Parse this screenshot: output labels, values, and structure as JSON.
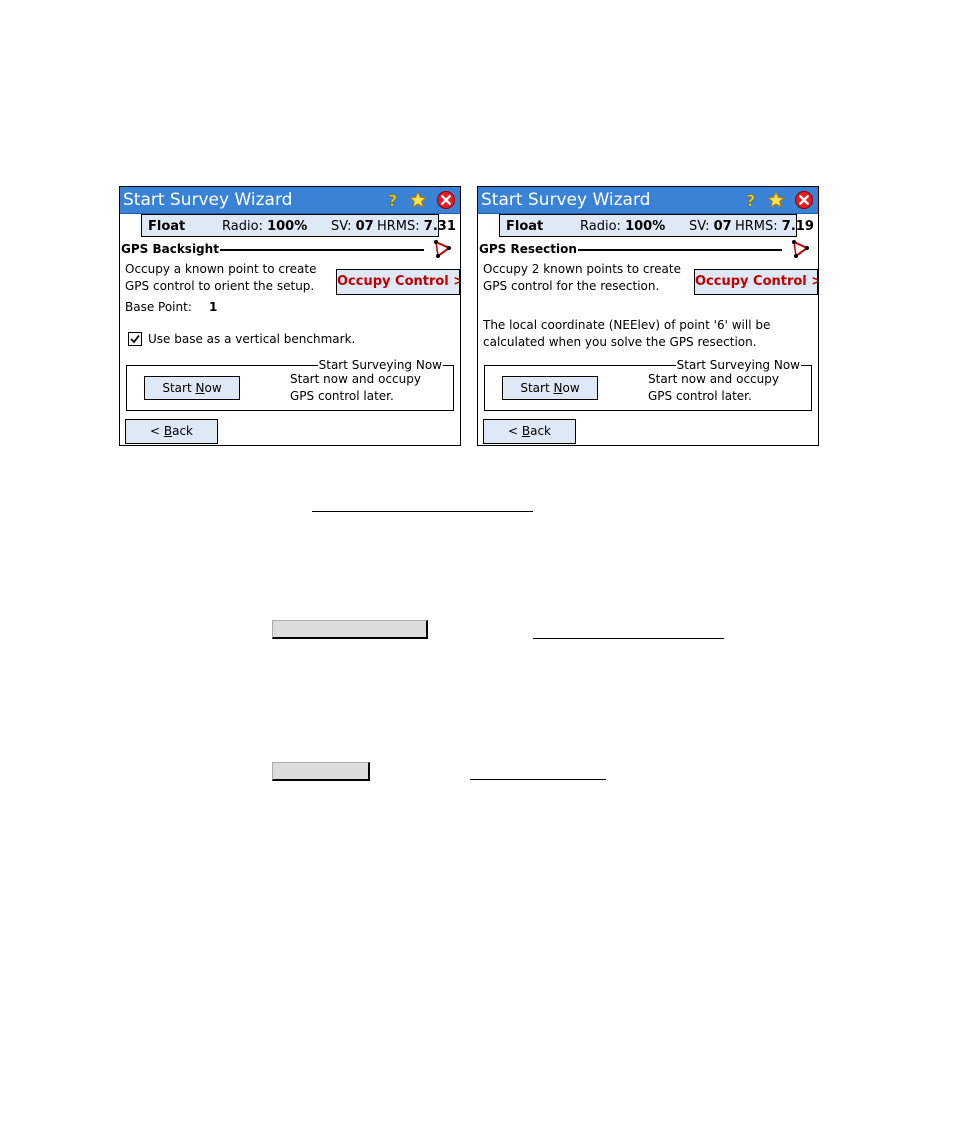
{
  "panels": [
    {
      "title": "Start Survey Wizard",
      "status": {
        "mode": "Float",
        "radio_label": "Radio:",
        "radio_value": "100%",
        "sv_label": "SV:",
        "sv_value": "07",
        "hrms_label": "HRMS:",
        "hrms_value": "7.31"
      },
      "section_title": "GPS Backsight",
      "desc_line1": "Occupy a known point to create",
      "desc_line2": "GPS control to orient the setup.",
      "occupy_label": "Occupy Control >",
      "base_point_label": "Base Point:",
      "base_point_value": "1",
      "checkbox_label": "Use base as a vertical benchmark.",
      "group_title": "Start Surveying Now",
      "start_pre": "Start ",
      "start_key": "N",
      "start_post": "ow",
      "group_line1": "Start now and occupy",
      "group_line2": "GPS control later.",
      "back_pre": "< ",
      "back_key": "B",
      "back_post": "ack"
    },
    {
      "title": "Start Survey Wizard",
      "status": {
        "mode": "Float",
        "radio_label": "Radio:",
        "radio_value": "100%",
        "sv_label": "SV:",
        "sv_value": "07",
        "hrms_label": "HRMS:",
        "hrms_value": "7.19"
      },
      "section_title": "GPS Resection",
      "desc_line1": "Occupy 2 known points to create",
      "desc_line2": "GPS control for the resection.",
      "occupy_label": "Occupy Control >",
      "note_line1": "The local coordinate (NEElev) of point '6' will be",
      "note_line2": "calculated when you solve the GPS resection.",
      "group_title": "Start Surveying Now",
      "start_pre": "Start ",
      "start_key": "N",
      "start_post": "ow",
      "group_line1": "Start now and occupy",
      "group_line2": "GPS control later.",
      "back_pre": "< ",
      "back_key": "B",
      "back_post": "ack"
    }
  ],
  "colors": {
    "titlebar": "#3a82d6",
    "button_face": "#dfe9f5",
    "occupy_text": "#c00000"
  }
}
